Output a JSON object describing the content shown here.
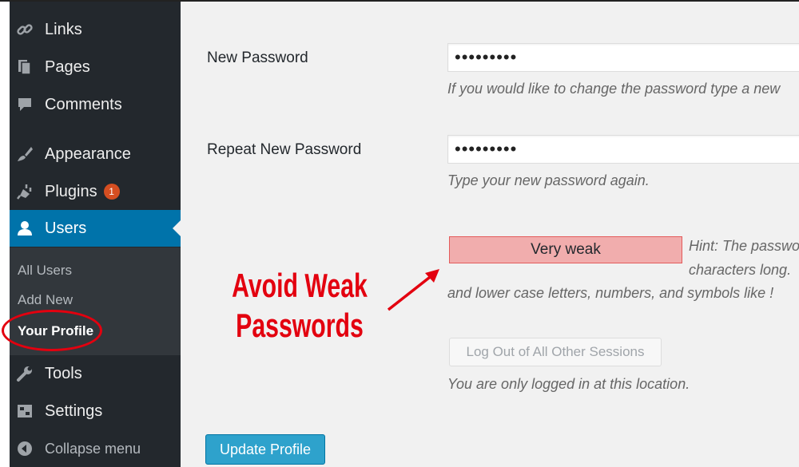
{
  "sidebar": {
    "items": [
      {
        "label": "Links",
        "icon": "link-icon"
      },
      {
        "label": "Pages",
        "icon": "pages-icon"
      },
      {
        "label": "Comments",
        "icon": "comment-icon"
      },
      {
        "label": "Appearance",
        "icon": "paintbrush-icon"
      },
      {
        "label": "Plugins",
        "icon": "plugin-icon",
        "badge": "1"
      },
      {
        "label": "Users",
        "icon": "user-icon",
        "active": true
      },
      {
        "label": "Tools",
        "icon": "wrench-icon"
      },
      {
        "label": "Settings",
        "icon": "settings-icon"
      },
      {
        "label": "Collapse menu",
        "icon": "collapse-icon"
      }
    ],
    "submenu": [
      "All Users",
      "Add New",
      "Your Profile"
    ]
  },
  "form": {
    "new_password_label": "New Password",
    "new_password_value": "•••••••••",
    "new_password_desc": "If you would like to change the password type a new",
    "repeat_password_label": "Repeat New Password",
    "repeat_password_value": "•••••••••",
    "repeat_password_desc": "Type your new password again.",
    "strength": "Very weak",
    "hint_line1": "Hint: The passwo",
    "hint_line2": "characters long.",
    "hint_line3": "and lower case letters, numbers, and symbols like !",
    "sessions_button": "Log Out of All Other Sessions",
    "sessions_desc": "You are only logged in at this location.",
    "update_button": "Update Profile"
  },
  "annotation": {
    "line1": "Avoid Weak",
    "line2": "Passwords",
    "color": "#e3000f"
  },
  "colors": {
    "sidebar_bg": "#23282d",
    "active_bg": "#0073aa",
    "badge": "#d54e21",
    "strength_bg": "#f1adad",
    "primary_button": "#2ea2cc"
  }
}
